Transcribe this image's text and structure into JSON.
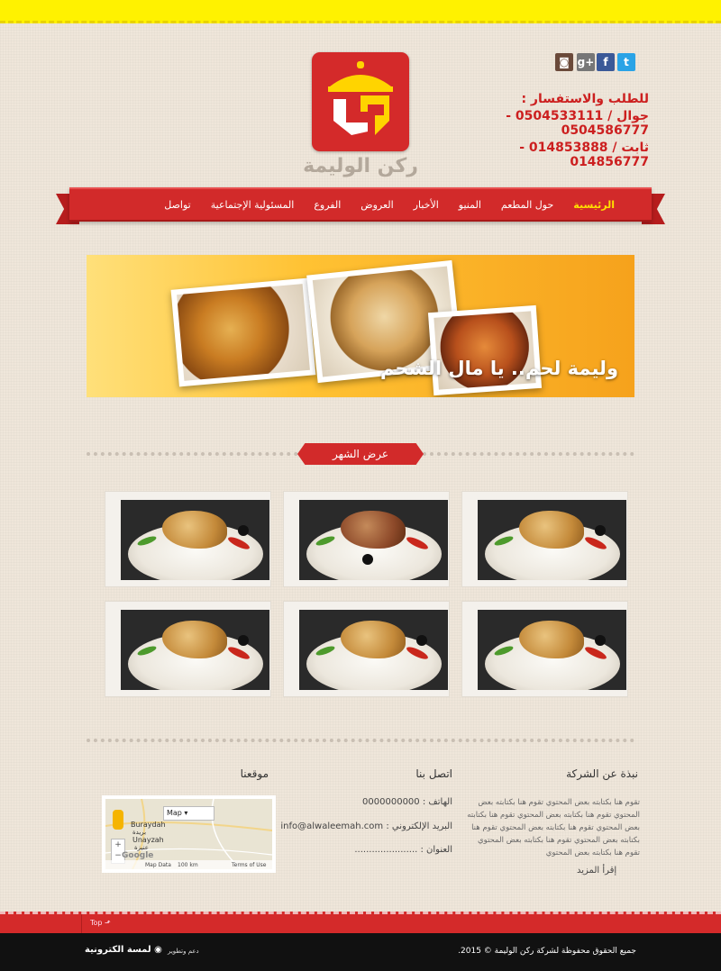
{
  "brand": {
    "logo_text": "ركن الوليمة",
    "logo_letters": "ر ك"
  },
  "social": [
    {
      "name": "instagram-icon",
      "glyph": "◙",
      "color": "#6b4a3a"
    },
    {
      "name": "google-plus-icon",
      "glyph": "g+",
      "color": "#777777"
    },
    {
      "name": "facebook-icon",
      "glyph": "f",
      "color": "#3b5998"
    },
    {
      "name": "twitter-icon",
      "glyph": "t",
      "color": "#2aa3e6"
    }
  ],
  "contact_header": {
    "title": "للطلب والاستفسار :",
    "mobile": "جوال / 0504533111 - 0504586777",
    "landline": "ثابت / 014853888 - 014856777"
  },
  "nav": {
    "items": [
      {
        "label": "الرئيسية",
        "active": true
      },
      {
        "label": "حول المطعم"
      },
      {
        "label": "المنيو"
      },
      {
        "label": "الأخبار"
      },
      {
        "label": "العروض"
      },
      {
        "label": "الفروع"
      },
      {
        "label": "المسئولية الإجتماعية"
      },
      {
        "label": "تواصل"
      }
    ]
  },
  "banner": {
    "caption": "وليمة لحم.. يا مال الشحم"
  },
  "section_title": "عرض الشهر",
  "gallery": {
    "count_rows": 2,
    "count_cols": 3
  },
  "footer": {
    "about": {
      "title": "نبذة عن الشركة",
      "text": "تقوم هنا بكتابته بعض المحتوي تقوم هنا بكتابته بعض المحتوي تقوم هنا بكتابته بعض المحتوي تقوم هنا بكتابته بعض المحتوي تقوم هنا بكتابته بعض المحتوي تقوم هنا بكتابته بعض المحتوي تقوم هنا بكتابته بعض المحتوي تقوم هنا بكتابته بعض المحتوي",
      "more": "إقرأ المزيد"
    },
    "contact": {
      "title": "اتصل بنا",
      "phone": "الهاتف : 0000000000",
      "email": "البريد الإلكتروني : info@alwaleemah.com",
      "address": "العنوان : ......................"
    },
    "location": {
      "title": "موقعنا",
      "map_label": "Map",
      "city1": "Buraydah",
      "city1_ar": "بريدة",
      "city2": "Unayzah",
      "city2_ar": "عنيزة",
      "map_data": "Map Data",
      "scale": "100 km",
      "terms": "Terms of Use",
      "google": "Google"
    },
    "top_link": "Top",
    "copyright": "جميع الحقوق محفوظة لشركة ركن الوليمة © 2015.",
    "dev_label": "دعم وتطوير",
    "dev_brand": "لمسة الكترونية"
  }
}
